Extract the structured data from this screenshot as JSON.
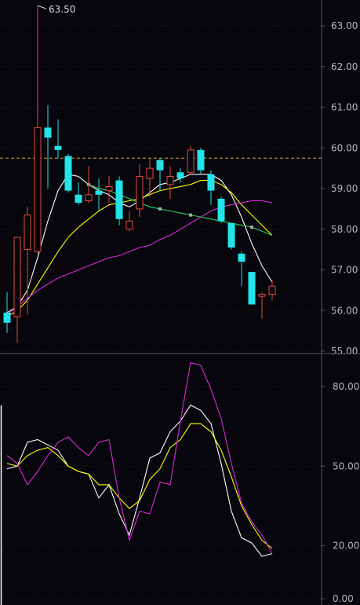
{
  "colors": {
    "background": "#06060c",
    "up": "#e24b3c",
    "down": "#22e4ea",
    "grid": "#5a1414",
    "axis": "#5a5a5a",
    "reference": "#e6a23c",
    "ma_white": "#ffffff",
    "ma_yellow": "#ffff00",
    "ma_green": "#27d15a",
    "ma_magenta": "#dd2ad8",
    "osc_white": "#ffffff",
    "osc_yellow": "#ffff00",
    "osc_magenta": "#dd2ad8"
  },
  "chart_data": [
    {
      "type": "candlestick",
      "title": "",
      "ylim": [
        55.0,
        63.8
      ],
      "y_ticks": [
        "63.00",
        "62.00",
        "61.00",
        "60.00",
        "59.00",
        "58.00",
        "57.00",
        "56.00",
        "55.00"
      ],
      "y_tick_values": [
        63,
        62,
        61,
        60,
        59,
        58,
        57,
        56,
        55
      ],
      "reference_line": 59.75,
      "peak_label": "63.50",
      "peak_value": 63.5,
      "candles": [
        {
          "o": 55.95,
          "h": 56.45,
          "l": 55.45,
          "c": 55.7
        },
        {
          "o": 55.85,
          "h": 57.7,
          "l": 55.2,
          "c": 57.8
        },
        {
          "o": 57.5,
          "h": 58.55,
          "l": 55.9,
          "c": 58.35
        },
        {
          "o": 57.45,
          "h": 63.5,
          "l": 57.4,
          "c": 60.5
        },
        {
          "o": 60.5,
          "h": 61.05,
          "l": 59.0,
          "c": 60.25
        },
        {
          "o": 60.05,
          "h": 60.7,
          "l": 59.75,
          "c": 59.95
        },
        {
          "o": 59.8,
          "h": 59.85,
          "l": 58.9,
          "c": 58.95
        },
        {
          "o": 58.85,
          "h": 59.15,
          "l": 58.6,
          "c": 58.65
        },
        {
          "o": 58.7,
          "h": 59.55,
          "l": 58.65,
          "c": 58.85
        },
        {
          "o": 58.95,
          "h": 59.25,
          "l": 58.45,
          "c": 58.85
        },
        {
          "o": 58.95,
          "h": 59.3,
          "l": 58.65,
          "c": 59.05
        },
        {
          "o": 59.2,
          "h": 59.3,
          "l": 58.1,
          "c": 58.25
        },
        {
          "o": 58.0,
          "h": 58.45,
          "l": 57.95,
          "c": 58.2
        },
        {
          "o": 58.5,
          "h": 59.6,
          "l": 58.3,
          "c": 59.3
        },
        {
          "o": 59.25,
          "h": 59.75,
          "l": 58.8,
          "c": 59.5
        },
        {
          "o": 59.7,
          "h": 59.75,
          "l": 58.95,
          "c": 59.45
        },
        {
          "o": 59.1,
          "h": 59.55,
          "l": 58.75,
          "c": 59.3
        },
        {
          "o": 59.4,
          "h": 59.5,
          "l": 59.15,
          "c": 59.25
        },
        {
          "o": 59.4,
          "h": 60.05,
          "l": 59.35,
          "c": 59.95
        },
        {
          "o": 59.95,
          "h": 60.0,
          "l": 59.35,
          "c": 59.45
        },
        {
          "o": 59.35,
          "h": 59.45,
          "l": 58.6,
          "c": 58.95
        },
        {
          "o": 58.75,
          "h": 58.8,
          "l": 58.15,
          "c": 58.2
        },
        {
          "o": 58.15,
          "h": 58.15,
          "l": 57.5,
          "c": 57.55
        },
        {
          "o": 57.4,
          "h": 57.45,
          "l": 56.6,
          "c": 57.2
        },
        {
          "o": 56.95,
          "h": 56.95,
          "l": 56.15,
          "c": 56.15
        },
        {
          "o": 56.35,
          "h": 56.45,
          "l": 55.8,
          "c": 56.4
        },
        {
          "o": 56.4,
          "h": 56.75,
          "l": 56.25,
          "c": 56.6
        }
      ],
      "moving_averages": [
        {
          "color_key": "ma_white",
          "values": [
            55.95,
            56.1,
            56.5,
            57.3,
            58.2,
            58.95,
            59.35,
            59.3,
            59.1,
            58.95,
            58.85,
            58.65,
            58.55,
            58.7,
            58.9,
            59.1,
            59.15,
            59.25,
            59.35,
            59.35,
            59.35,
            59.2,
            58.85,
            58.3,
            57.65,
            57.1,
            56.7
          ]
        },
        {
          "color_key": "ma_yellow",
          "values": [
            55.85,
            56.0,
            56.25,
            56.65,
            57.05,
            57.45,
            57.8,
            58.05,
            58.25,
            58.45,
            58.6,
            58.65,
            58.7,
            58.75,
            58.85,
            58.95,
            59.0,
            59.05,
            59.1,
            59.2,
            59.2,
            59.1,
            58.9,
            58.6,
            58.35,
            58.1,
            57.85
          ]
        },
        {
          "color_key": "ma_green",
          "values": [
            null,
            null,
            null,
            null,
            null,
            null,
            null,
            null,
            59.1,
            59.0,
            58.95,
            58.85,
            58.75,
            58.65,
            58.55,
            58.5,
            58.45,
            58.4,
            58.35,
            58.3,
            58.25,
            58.2,
            58.15,
            58.1,
            58.05,
            57.95,
            57.85
          ]
        },
        {
          "color_key": "ma_magenta",
          "values": [
            55.9,
            56.1,
            56.3,
            56.5,
            56.65,
            56.8,
            56.9,
            57.0,
            57.1,
            57.2,
            57.3,
            57.35,
            57.45,
            57.55,
            57.6,
            57.75,
            57.85,
            58.0,
            58.15,
            58.3,
            58.45,
            58.55,
            58.6,
            58.65,
            58.7,
            58.7,
            58.65
          ]
        }
      ]
    },
    {
      "type": "line",
      "title": "",
      "ylim": [
        0,
        91
      ],
      "y_ticks": [
        "80.00",
        "50.00",
        "20.00",
        "0.00"
      ],
      "y_tick_values": [
        80,
        50,
        20,
        0
      ],
      "series": [
        {
          "color_key": "osc_white",
          "values": [
            49,
            50,
            59,
            60,
            58,
            56,
            50,
            48,
            47,
            38,
            43,
            32,
            24,
            38,
            53,
            55,
            63,
            67,
            73,
            71,
            66,
            51,
            33,
            23,
            21,
            16,
            17
          ]
        },
        {
          "color_key": "osc_yellow",
          "values": [
            51,
            50,
            54,
            56,
            57,
            54,
            50,
            48,
            47,
            43,
            43,
            38,
            34,
            37,
            45,
            49,
            57,
            60,
            66,
            66,
            63,
            56,
            46,
            35,
            28,
            22,
            19
          ]
        },
        {
          "color_key": "osc_magenta",
          "values": [
            54,
            51,
            43,
            48,
            54,
            59,
            61,
            57,
            54,
            59,
            60,
            38,
            22,
            33,
            32,
            44,
            43,
            67,
            89,
            88,
            79,
            68,
            51,
            36,
            29,
            24,
            17
          ]
        }
      ]
    }
  ]
}
